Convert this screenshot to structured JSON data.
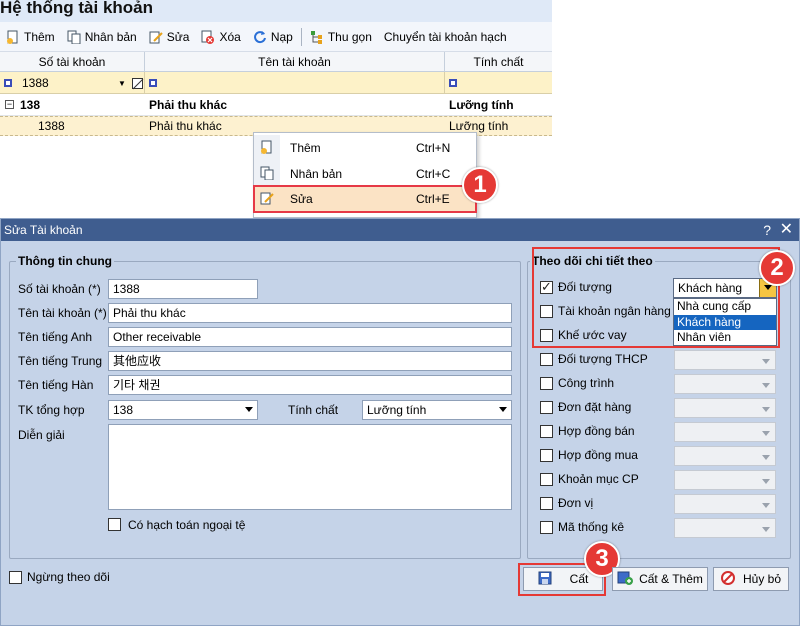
{
  "bg": {
    "title": "Hệ thống tài khoản",
    "toolbar": {
      "add": "Thêm",
      "duplicate": "Nhân bản",
      "edit": "Sửa",
      "delete": "Xóa",
      "load": "Nạp",
      "collapse": "Thu gọn",
      "transfer": "Chuyển tài khoản hạch"
    },
    "grid": {
      "columns": [
        "Số tài khoản",
        "Tên tài khoản",
        "Tính chất"
      ],
      "filter_account": "1388",
      "group_row": {
        "account": "138",
        "name": "Phải thu khác",
        "nature": "Lưỡng tính"
      },
      "data_row": {
        "account": "1388",
        "name": "Phải thu khác",
        "nature": "Lưỡng tính"
      }
    }
  },
  "context_menu": {
    "items": [
      {
        "label": "Thêm",
        "shortcut": "Ctrl+N"
      },
      {
        "label": "Nhân bản",
        "shortcut": "Ctrl+C"
      },
      {
        "label": "Sửa",
        "shortcut": "Ctrl+E"
      }
    ]
  },
  "badges": {
    "one": "1",
    "two": "2",
    "three": "3"
  },
  "dialog": {
    "title": "Sửa Tài khoản",
    "help": "?",
    "close": "✕",
    "general": {
      "legend": "Thông tin chung",
      "account_no_label": "Số tài khoản (*)",
      "account_no_value": "1388",
      "account_name_label": "Tên tài khoản (*)",
      "account_name_value": "Phải thu khác",
      "english_label": "Tên tiếng Anh",
      "english_value": "Other receivable",
      "chinese_label": "Tên tiếng Trung",
      "chinese_value": "其他应收",
      "korean_label": "Tên tiếng Hàn",
      "korean_value": "기타 채권",
      "parent_label": "TK tổng hợp",
      "parent_value": "138",
      "nature_label": "Tính chất",
      "nature_value": "Lưỡng tính",
      "description_label": "Diễn giải",
      "description_value": "",
      "foreign_currency_label": "Có hạch toán ngoại tệ"
    },
    "tracking": {
      "legend": "Theo dõi chi tiết theo",
      "items": [
        {
          "label": "Đối tượng",
          "checked": true,
          "value": "Khách hàng"
        },
        {
          "label": "Tài khoản ngân hàng",
          "checked": false
        },
        {
          "label": "Khế ước vay",
          "checked": false
        },
        {
          "label": "Đối tượng THCP",
          "checked": false
        },
        {
          "label": "Công trình",
          "checked": false
        },
        {
          "label": "Đơn đặt hàng",
          "checked": false
        },
        {
          "label": "Hợp đồng bán",
          "checked": false
        },
        {
          "label": "Hợp đồng mua",
          "checked": false
        },
        {
          "label": "Khoản mục CP",
          "checked": false
        },
        {
          "label": "Đơn vị",
          "checked": false
        },
        {
          "label": "Mã thống kê",
          "checked": false
        }
      ],
      "dropdown_options": [
        "Nhà cung cấp",
        "Khách hàng",
        "Nhân viên"
      ],
      "dropdown_selected": "Khách hàng"
    },
    "stop_tracking_label": "Ngừng theo dõi",
    "buttons": {
      "save": "Cất",
      "save_add": "Cất & Thêm",
      "cancel": "Hủy bỏ"
    }
  },
  "colors": {
    "accent_red": "#e53935",
    "dialog_title": "#3f5d8f",
    "selection_blue": "#1565c0"
  }
}
